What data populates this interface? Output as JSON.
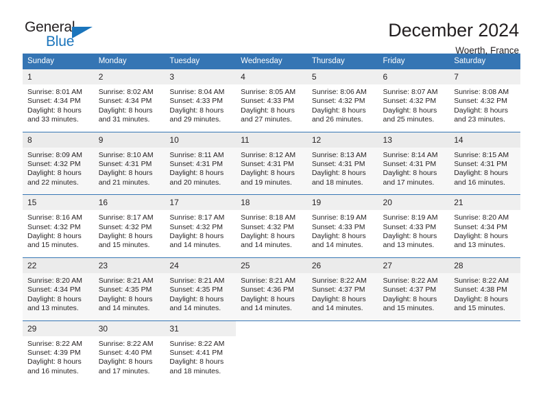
{
  "logo": {
    "part1": "General",
    "part2": "Blue",
    "accent_color": "#1b75bc",
    "triangle": "blue-triangle"
  },
  "header": {
    "title": "December 2024",
    "subtitle": "Woerth, France"
  },
  "colors": {
    "header_bar": "#3575b4",
    "day_band": "#efefef",
    "alt_row": "#f7f7f7",
    "text": "#231f20"
  },
  "calendar": {
    "weekdays": [
      "Sunday",
      "Monday",
      "Tuesday",
      "Wednesday",
      "Thursday",
      "Friday",
      "Saturday"
    ],
    "weeks": [
      {
        "alt": false,
        "days": [
          {
            "num": "1",
            "sunrise": "Sunrise: 8:01 AM",
            "sunset": "Sunset: 4:34 PM",
            "daylight1": "Daylight: 8 hours",
            "daylight2": "and 33 minutes."
          },
          {
            "num": "2",
            "sunrise": "Sunrise: 8:02 AM",
            "sunset": "Sunset: 4:34 PM",
            "daylight1": "Daylight: 8 hours",
            "daylight2": "and 31 minutes."
          },
          {
            "num": "3",
            "sunrise": "Sunrise: 8:04 AM",
            "sunset": "Sunset: 4:33 PM",
            "daylight1": "Daylight: 8 hours",
            "daylight2": "and 29 minutes."
          },
          {
            "num": "4",
            "sunrise": "Sunrise: 8:05 AM",
            "sunset": "Sunset: 4:33 PM",
            "daylight1": "Daylight: 8 hours",
            "daylight2": "and 27 minutes."
          },
          {
            "num": "5",
            "sunrise": "Sunrise: 8:06 AM",
            "sunset": "Sunset: 4:32 PM",
            "daylight1": "Daylight: 8 hours",
            "daylight2": "and 26 minutes."
          },
          {
            "num": "6",
            "sunrise": "Sunrise: 8:07 AM",
            "sunset": "Sunset: 4:32 PM",
            "daylight1": "Daylight: 8 hours",
            "daylight2": "and 25 minutes."
          },
          {
            "num": "7",
            "sunrise": "Sunrise: 8:08 AM",
            "sunset": "Sunset: 4:32 PM",
            "daylight1": "Daylight: 8 hours",
            "daylight2": "and 23 minutes."
          }
        ]
      },
      {
        "alt": true,
        "days": [
          {
            "num": "8",
            "sunrise": "Sunrise: 8:09 AM",
            "sunset": "Sunset: 4:32 PM",
            "daylight1": "Daylight: 8 hours",
            "daylight2": "and 22 minutes."
          },
          {
            "num": "9",
            "sunrise": "Sunrise: 8:10 AM",
            "sunset": "Sunset: 4:31 PM",
            "daylight1": "Daylight: 8 hours",
            "daylight2": "and 21 minutes."
          },
          {
            "num": "10",
            "sunrise": "Sunrise: 8:11 AM",
            "sunset": "Sunset: 4:31 PM",
            "daylight1": "Daylight: 8 hours",
            "daylight2": "and 20 minutes."
          },
          {
            "num": "11",
            "sunrise": "Sunrise: 8:12 AM",
            "sunset": "Sunset: 4:31 PM",
            "daylight1": "Daylight: 8 hours",
            "daylight2": "and 19 minutes."
          },
          {
            "num": "12",
            "sunrise": "Sunrise: 8:13 AM",
            "sunset": "Sunset: 4:31 PM",
            "daylight1": "Daylight: 8 hours",
            "daylight2": "and 18 minutes."
          },
          {
            "num": "13",
            "sunrise": "Sunrise: 8:14 AM",
            "sunset": "Sunset: 4:31 PM",
            "daylight1": "Daylight: 8 hours",
            "daylight2": "and 17 minutes."
          },
          {
            "num": "14",
            "sunrise": "Sunrise: 8:15 AM",
            "sunset": "Sunset: 4:31 PM",
            "daylight1": "Daylight: 8 hours",
            "daylight2": "and 16 minutes."
          }
        ]
      },
      {
        "alt": false,
        "days": [
          {
            "num": "15",
            "sunrise": "Sunrise: 8:16 AM",
            "sunset": "Sunset: 4:32 PM",
            "daylight1": "Daylight: 8 hours",
            "daylight2": "and 15 minutes."
          },
          {
            "num": "16",
            "sunrise": "Sunrise: 8:17 AM",
            "sunset": "Sunset: 4:32 PM",
            "daylight1": "Daylight: 8 hours",
            "daylight2": "and 15 minutes."
          },
          {
            "num": "17",
            "sunrise": "Sunrise: 8:17 AM",
            "sunset": "Sunset: 4:32 PM",
            "daylight1": "Daylight: 8 hours",
            "daylight2": "and 14 minutes."
          },
          {
            "num": "18",
            "sunrise": "Sunrise: 8:18 AM",
            "sunset": "Sunset: 4:32 PM",
            "daylight1": "Daylight: 8 hours",
            "daylight2": "and 14 minutes."
          },
          {
            "num": "19",
            "sunrise": "Sunrise: 8:19 AM",
            "sunset": "Sunset: 4:33 PM",
            "daylight1": "Daylight: 8 hours",
            "daylight2": "and 14 minutes."
          },
          {
            "num": "20",
            "sunrise": "Sunrise: 8:19 AM",
            "sunset": "Sunset: 4:33 PM",
            "daylight1": "Daylight: 8 hours",
            "daylight2": "and 13 minutes."
          },
          {
            "num": "21",
            "sunrise": "Sunrise: 8:20 AM",
            "sunset": "Sunset: 4:34 PM",
            "daylight1": "Daylight: 8 hours",
            "daylight2": "and 13 minutes."
          }
        ]
      },
      {
        "alt": true,
        "days": [
          {
            "num": "22",
            "sunrise": "Sunrise: 8:20 AM",
            "sunset": "Sunset: 4:34 PM",
            "daylight1": "Daylight: 8 hours",
            "daylight2": "and 13 minutes."
          },
          {
            "num": "23",
            "sunrise": "Sunrise: 8:21 AM",
            "sunset": "Sunset: 4:35 PM",
            "daylight1": "Daylight: 8 hours",
            "daylight2": "and 14 minutes."
          },
          {
            "num": "24",
            "sunrise": "Sunrise: 8:21 AM",
            "sunset": "Sunset: 4:35 PM",
            "daylight1": "Daylight: 8 hours",
            "daylight2": "and 14 minutes."
          },
          {
            "num": "25",
            "sunrise": "Sunrise: 8:21 AM",
            "sunset": "Sunset: 4:36 PM",
            "daylight1": "Daylight: 8 hours",
            "daylight2": "and 14 minutes."
          },
          {
            "num": "26",
            "sunrise": "Sunrise: 8:22 AM",
            "sunset": "Sunset: 4:37 PM",
            "daylight1": "Daylight: 8 hours",
            "daylight2": "and 14 minutes."
          },
          {
            "num": "27",
            "sunrise": "Sunrise: 8:22 AM",
            "sunset": "Sunset: 4:37 PM",
            "daylight1": "Daylight: 8 hours",
            "daylight2": "and 15 minutes."
          },
          {
            "num": "28",
            "sunrise": "Sunrise: 8:22 AM",
            "sunset": "Sunset: 4:38 PM",
            "daylight1": "Daylight: 8 hours",
            "daylight2": "and 15 minutes."
          }
        ]
      },
      {
        "alt": false,
        "days": [
          {
            "num": "29",
            "sunrise": "Sunrise: 8:22 AM",
            "sunset": "Sunset: 4:39 PM",
            "daylight1": "Daylight: 8 hours",
            "daylight2": "and 16 minutes."
          },
          {
            "num": "30",
            "sunrise": "Sunrise: 8:22 AM",
            "sunset": "Sunset: 4:40 PM",
            "daylight1": "Daylight: 8 hours",
            "daylight2": "and 17 minutes."
          },
          {
            "num": "31",
            "sunrise": "Sunrise: 8:22 AM",
            "sunset": "Sunset: 4:41 PM",
            "daylight1": "Daylight: 8 hours",
            "daylight2": "and 18 minutes."
          },
          {
            "num": "",
            "sunrise": "",
            "sunset": "",
            "daylight1": "",
            "daylight2": ""
          },
          {
            "num": "",
            "sunrise": "",
            "sunset": "",
            "daylight1": "",
            "daylight2": ""
          },
          {
            "num": "",
            "sunrise": "",
            "sunset": "",
            "daylight1": "",
            "daylight2": ""
          },
          {
            "num": "",
            "sunrise": "",
            "sunset": "",
            "daylight1": "",
            "daylight2": ""
          }
        ]
      }
    ]
  }
}
